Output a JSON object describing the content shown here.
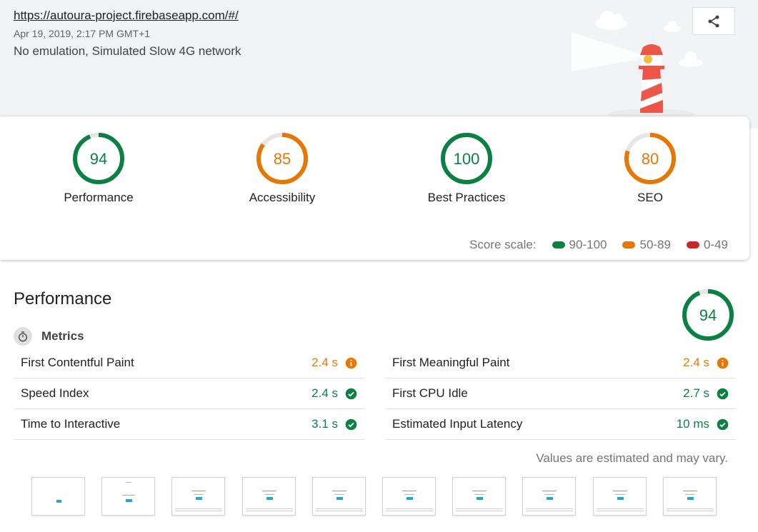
{
  "header": {
    "url": "https://autoura-project.firebaseapp.com/#/",
    "date": "Apr 19, 2019, 2:17 PM GMT+1",
    "environment": "No emulation, Simulated Slow 4G network",
    "share_icon": "share-icon"
  },
  "scores": [
    {
      "label": "Performance",
      "value": "94",
      "status": "pass",
      "fraction": 0.94
    },
    {
      "label": "Accessibility",
      "value": "85",
      "status": "average",
      "fraction": 0.85
    },
    {
      "label": "Best Practices",
      "value": "100",
      "status": "pass",
      "fraction": 1.0
    },
    {
      "label": "SEO",
      "value": "80",
      "status": "average",
      "fraction": 0.8
    }
  ],
  "scale": {
    "label": "Score scale:",
    "ranges": [
      "90-100",
      "50-89",
      "0-49"
    ]
  },
  "colors": {
    "pass": "#0cce6b",
    "pass_text": "#0b8043",
    "average": "#e67700",
    "fail": "#c62828"
  },
  "performance": {
    "title": "Performance",
    "score": "94",
    "fraction": 0.94,
    "metrics_label": "Metrics",
    "metrics_left": [
      {
        "name": "First Contentful Paint",
        "value": "2.4 s",
        "status": "average"
      },
      {
        "name": "Speed Index",
        "value": "2.4 s",
        "status": "pass"
      },
      {
        "name": "Time to Interactive",
        "value": "3.1 s",
        "status": "pass"
      }
    ],
    "metrics_right": [
      {
        "name": "First Meaningful Paint",
        "value": "2.4 s",
        "status": "average"
      },
      {
        "name": "First CPU Idle",
        "value": "2.7 s",
        "status": "pass"
      },
      {
        "name": "Estimated Input Latency",
        "value": "10 ms",
        "status": "pass"
      }
    ],
    "note": "Values are estimated and may vary."
  }
}
